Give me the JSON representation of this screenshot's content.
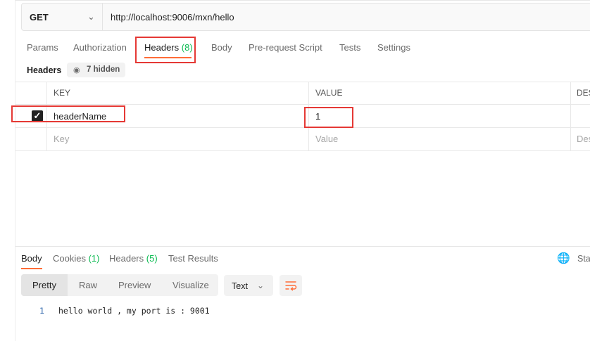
{
  "request": {
    "method": "GET",
    "url": "http://localhost:9006/mxn/hello"
  },
  "request_tabs": {
    "params": "Params",
    "authorization": "Authorization",
    "headers": "Headers",
    "headers_count": "(8)",
    "body": "Body",
    "pre_request_script": "Pre-request Script",
    "tests": "Tests",
    "settings": "Settings"
  },
  "headers_section": {
    "label": "Headers",
    "hidden_text": "7 hidden"
  },
  "table": {
    "col_key": "KEY",
    "col_value": "VALUE",
    "col_desc": "DES",
    "rows": [
      {
        "checked": true,
        "key": "headerName",
        "value": "1"
      }
    ],
    "placeholder_key": "Key",
    "placeholder_value": "Value",
    "placeholder_desc": "Des"
  },
  "response_tabs": {
    "body": "Body",
    "cookies": "Cookies",
    "cookies_count": "(1)",
    "headers": "Headers",
    "headers_count": "(5)",
    "test_results": "Test Results",
    "status_partial": "Sta"
  },
  "response_view": {
    "pretty": "Pretty",
    "raw": "Raw",
    "preview": "Preview",
    "visualize": "Visualize",
    "format": "Text"
  },
  "response_body": {
    "line_number": "1",
    "line_text": "hello world , my port is : 9001"
  },
  "colors": {
    "accent": "#ff6c37",
    "count_green": "#0cbb52",
    "annotation_red": "#e53935"
  }
}
